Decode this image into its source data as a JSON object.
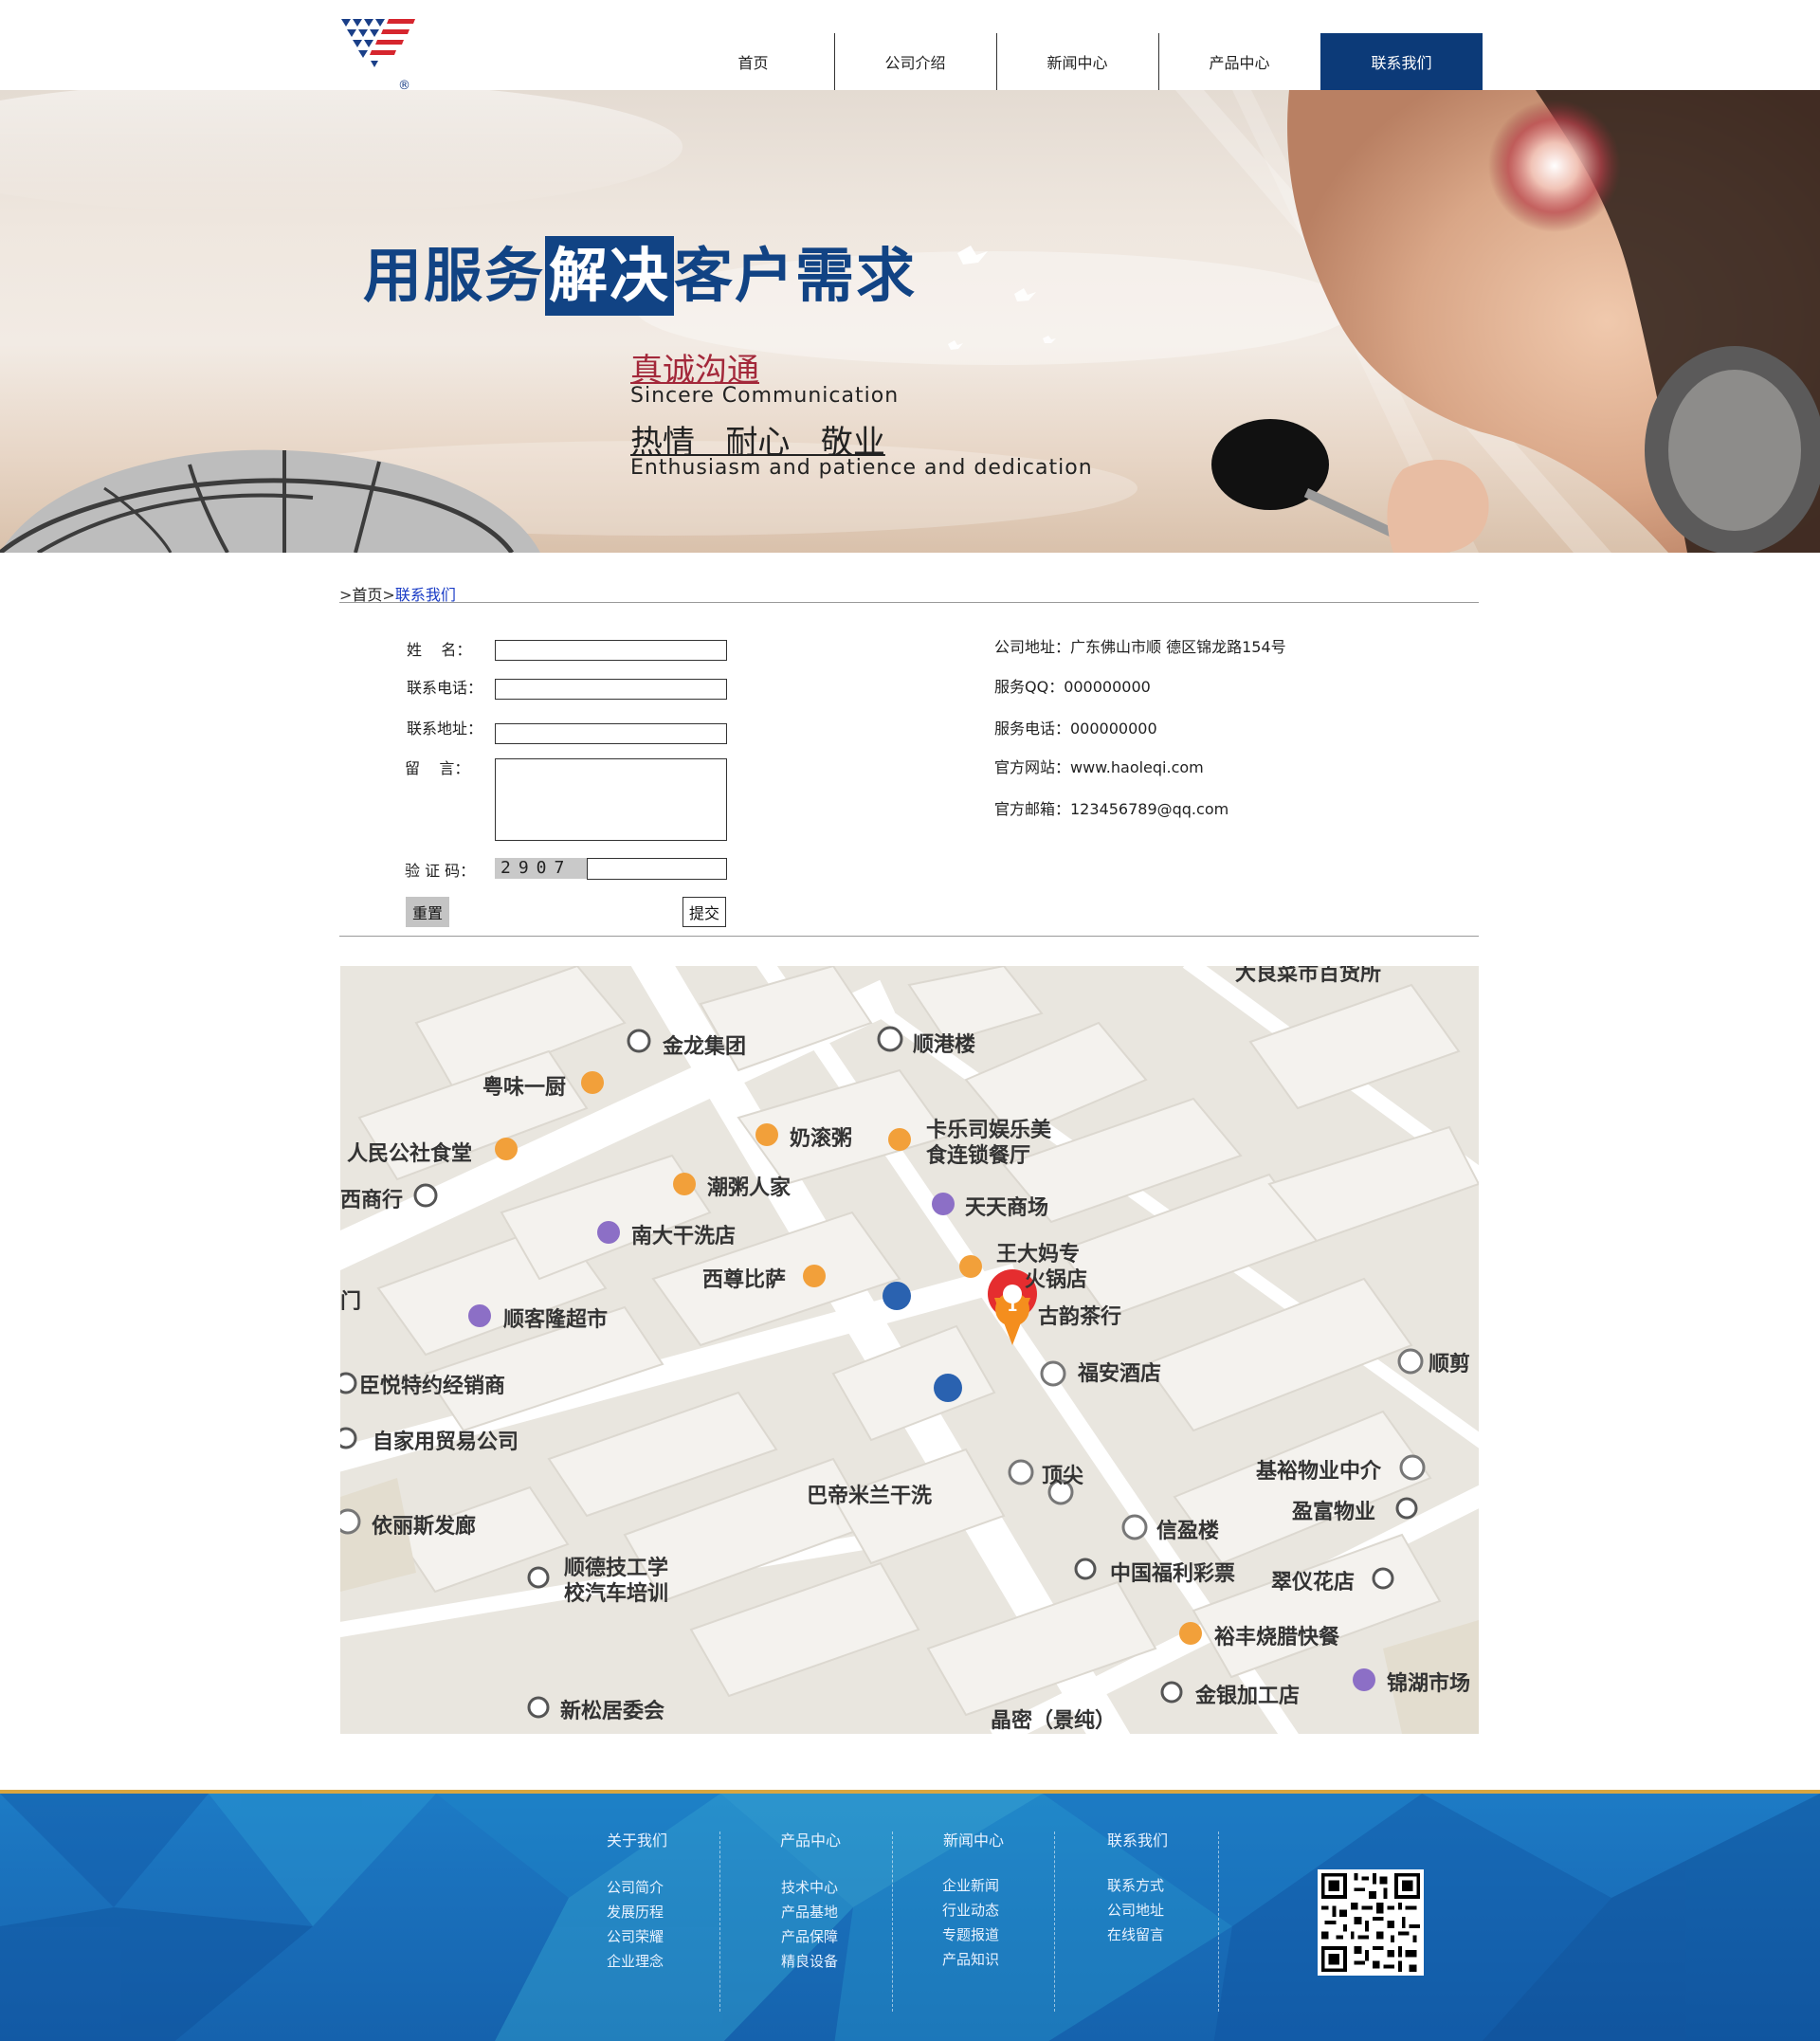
{
  "nav": {
    "items": [
      {
        "label": "首页",
        "active": false
      },
      {
        "label": "公司介绍",
        "active": false
      },
      {
        "label": "新闻中心",
        "active": false
      },
      {
        "label": "产品中心",
        "active": false
      },
      {
        "label": "联系我们",
        "active": true
      }
    ]
  },
  "banner": {
    "slogan_pre": "用服务",
    "slogan_highlight": "解决",
    "slogan_post": "客户需求",
    "sub_cn_1": "真诚沟通",
    "sub_en_1": "Sincere Communication",
    "sub_cn_2": "热情   耐心   敬业",
    "sub_en_2": "Enthusiasm and patience and dedication"
  },
  "breadcrumb": {
    "sep": ">",
    "home": "首页",
    "current": "联系我们"
  },
  "form": {
    "name_label": "姓    名：",
    "phone_label": "联系电话：",
    "address_label": "联系地址：",
    "message_label": "留    言：",
    "captcha_label": "验 证 码：",
    "captcha_value": "2907",
    "reset_label": "重置",
    "submit_label": "提交"
  },
  "contact_info": {
    "address": "公司地址：广东佛山市顺 德区锦龙路154号",
    "qq": "服务QQ：000000000",
    "phone": "服务电话：000000000",
    "website": "官方网站：www.haoleqi.com",
    "email": "官方邮箱：123456789@qq.com"
  },
  "map": {
    "marker_number": "1",
    "labels": [
      "大良菜市百货所",
      "金龙集团",
      "顺港楼",
      "粤味一厨",
      "奶滚粥",
      "卡乐司娱乐美",
      "食连锁餐厅",
      "人民公社食堂",
      "潮粥人家",
      "天天商场",
      "西商行",
      "南大干洗店",
      "王大妈专",
      "火锅店",
      "西尊比萨",
      "古韵茶行",
      "门",
      "顺客隆超市",
      "福安酒店",
      "顺剪",
      "臣悦特约经销商",
      "自家用贸易公司",
      "顶尖",
      "基裕物业中介",
      "巴帝米兰干洗",
      "盈富物业",
      "依丽斯发廊",
      "信盈楼",
      "顺德技工学",
      "校汽车培训",
      "中国福利彩票",
      "翠仪花店",
      "裕丰烧腊快餐",
      "锦湖市场",
      "金银加工店",
      "新松居委会",
      "晶密（景纯）"
    ]
  },
  "footer": {
    "columns": [
      {
        "title": "关于我们",
        "links": [
          "公司简介",
          "发展历程",
          "公司荣耀",
          "企业理念"
        ]
      },
      {
        "title": "产品中心",
        "links": [
          "技术中心",
          "产品基地",
          "产品保障",
          "精良设备"
        ]
      },
      {
        "title": "新闻中心",
        "links": [
          "企业新闻",
          "行业动态",
          "专题报道",
          "产品知识"
        ]
      },
      {
        "title": "联系我们",
        "links": [
          "联系方式",
          "公司地址",
          "在线留言"
        ]
      }
    ]
  },
  "colors": {
    "brand_blue": "#0c3a78",
    "slogan_blue": "#114384",
    "accent_red": "#a3283a",
    "footer_blue": "#1a70bb",
    "footer_gold": "#d9a640"
  }
}
